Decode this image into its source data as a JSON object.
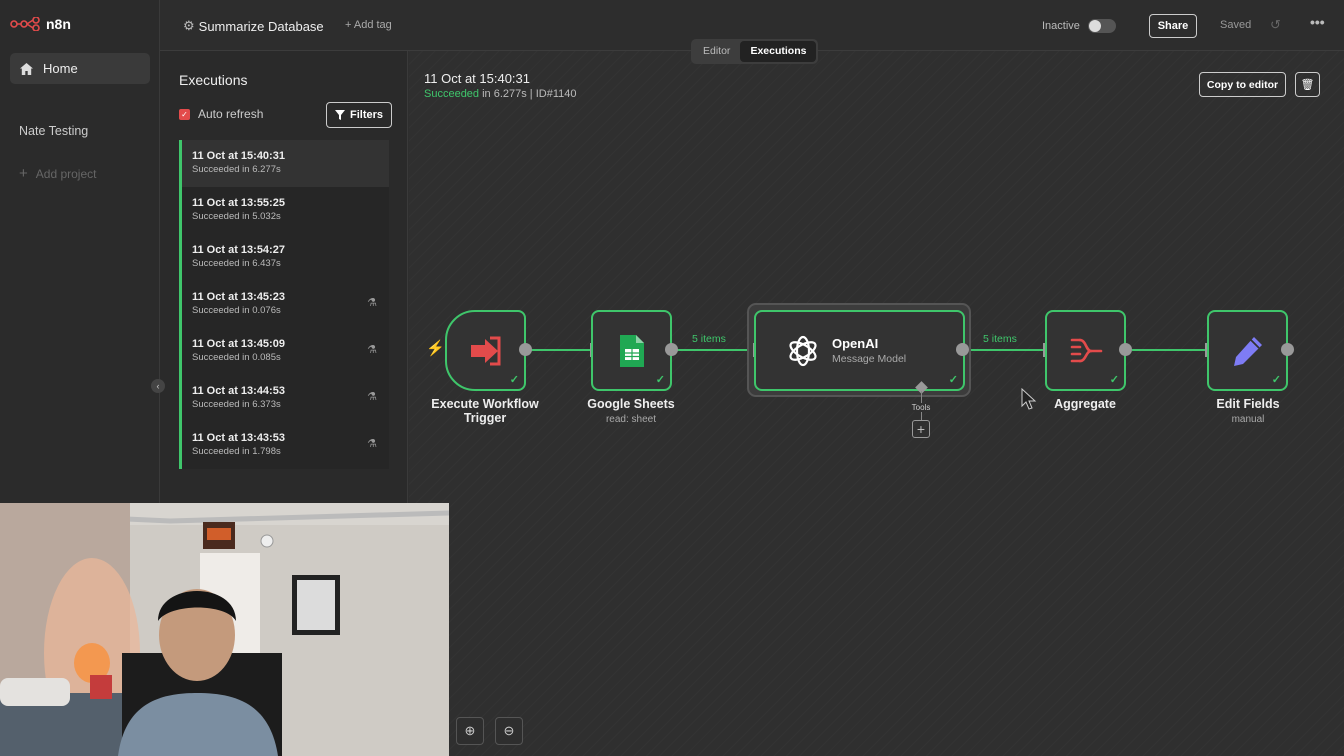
{
  "app": {
    "name": "n8n"
  },
  "sidebar": {
    "home_label": "Home",
    "project": "Nate Testing",
    "add_project": "Add project"
  },
  "header": {
    "workflow_title": "Summarize Database",
    "add_tag": "+ Add tag",
    "status": "Inactive",
    "share": "Share",
    "saved": "Saved",
    "tabs": [
      {
        "label": "Editor"
      },
      {
        "label": "Executions"
      }
    ]
  },
  "executions": {
    "title": "Executions",
    "auto_refresh": "Auto refresh",
    "filters": "Filters",
    "items": [
      {
        "time": "11 Oct at 15:40:31",
        "status": "Succeeded in 6.277s"
      },
      {
        "time": "11 Oct at 13:55:25",
        "status": "Succeeded in 5.032s"
      },
      {
        "time": "11 Oct at 13:54:27",
        "status": "Succeeded in 6.437s"
      },
      {
        "time": "11 Oct at 13:45:23",
        "status": "Succeeded in 0.076s"
      },
      {
        "time": "11 Oct at 13:45:09",
        "status": "Succeeded in 0.085s"
      },
      {
        "time": "11 Oct at 13:44:53",
        "status": "Succeeded in 6.373s"
      },
      {
        "time": "11 Oct at 13:43:53",
        "status": "Succeeded in 1.798s"
      }
    ]
  },
  "detail": {
    "title": "11 Oct at 15:40:31",
    "status": "Succeeded",
    "rest": " in 6.277s | ID#1140",
    "copy_button": "Copy to editor"
  },
  "nodes": [
    {
      "label": "Execute Workflow\nTrigger",
      "sub": ""
    },
    {
      "label": "Google Sheets",
      "sub": "read: sheet"
    },
    {
      "label": "OpenAI",
      "sub": "Message Model"
    },
    {
      "label": "Aggregate",
      "sub": ""
    },
    {
      "label": "Edit Fields",
      "sub": "manual"
    }
  ],
  "connections": {
    "items_1": "5 items",
    "items_2": "5 items",
    "tools": "Tools"
  },
  "colors": {
    "success": "#3fc66b",
    "accent": "#e34b4b",
    "bg": "#2e2e2e"
  }
}
